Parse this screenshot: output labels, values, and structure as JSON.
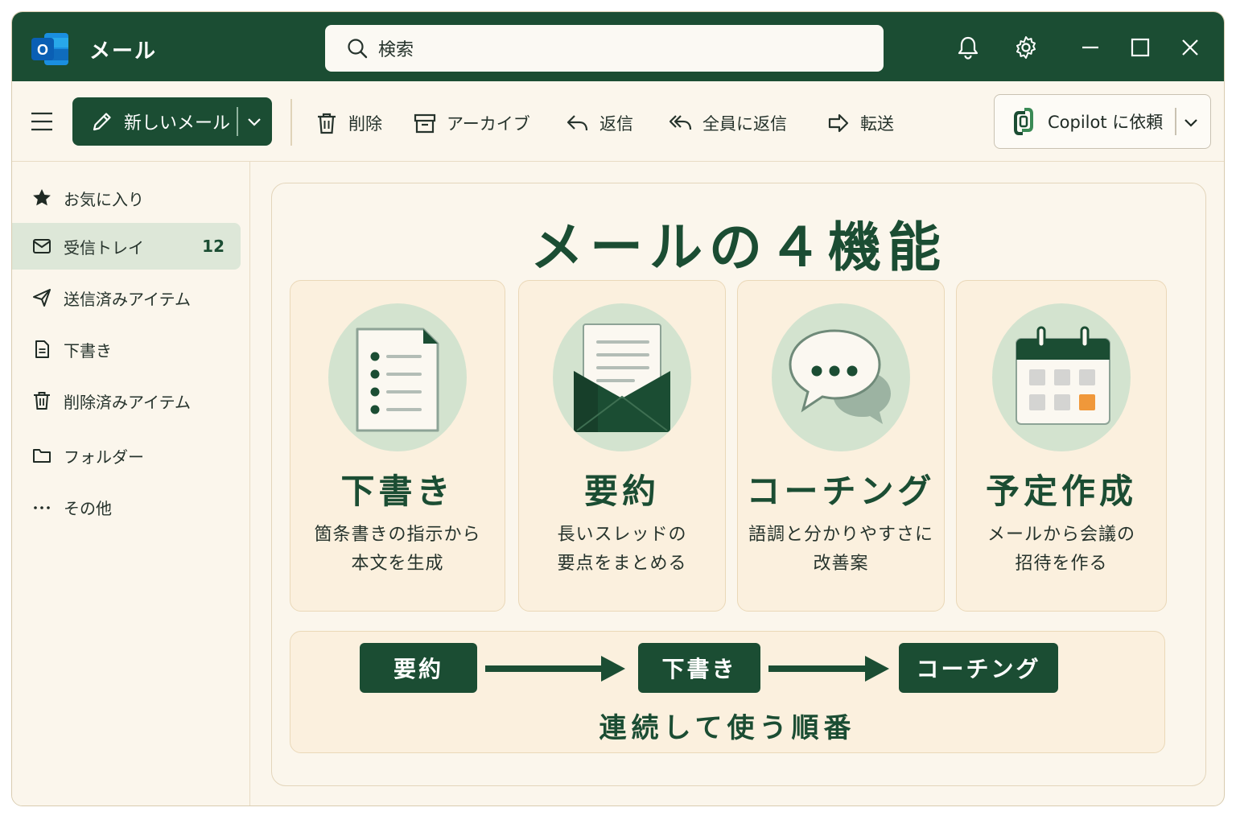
{
  "window": {
    "app_title": "メール",
    "search_placeholder": "検索"
  },
  "toolbar": {
    "new_mail_label": "新しいメール",
    "delete_label": "削除",
    "archive_label": "アーカイブ",
    "reply_label": "返信",
    "reply_all_label": "全員に返信",
    "forward_label": "転送",
    "copilot_label": "Copilot に依頼"
  },
  "sidebar": {
    "items": [
      {
        "label": "お気に入り",
        "icon": "star-icon"
      },
      {
        "label": "受信トレイ",
        "icon": "inbox-icon",
        "count": "12",
        "active": true
      },
      {
        "label": "送信済みアイテム",
        "icon": "send-icon"
      },
      {
        "label": "下書き",
        "icon": "document-icon"
      },
      {
        "label": "削除済みアイテム",
        "icon": "trash-icon"
      },
      {
        "label": "フォルダー",
        "icon": "folder-icon"
      },
      {
        "label": "その他",
        "icon": "more-icon"
      }
    ]
  },
  "main": {
    "title": "メールの４機能",
    "cards": [
      {
        "title": "下書き",
        "desc1": "箇条書きの指示から",
        "desc2": "本文を生成",
        "icon": "document-list-icon"
      },
      {
        "title": "要約",
        "desc1": "長いスレッドの",
        "desc2": "要点をまとめる",
        "icon": "open-envelope-icon"
      },
      {
        "title": "コーチング",
        "desc1": "語調と分かりやすさに",
        "desc2": "改善案",
        "icon": "chat-bubbles-icon"
      },
      {
        "title": "予定作成",
        "desc1": "メールから会議の",
        "desc2": "招待を作る",
        "icon": "calendar-icon"
      }
    ],
    "flow": {
      "steps": [
        "要約",
        "下書き",
        "コーチング"
      ],
      "caption": "連続して使う順番"
    }
  },
  "colors": {
    "brand_green": "#1b4d33",
    "background": "#fbf6ec",
    "card_bg": "#fbf0de",
    "accent_orange": "#f0983a"
  }
}
